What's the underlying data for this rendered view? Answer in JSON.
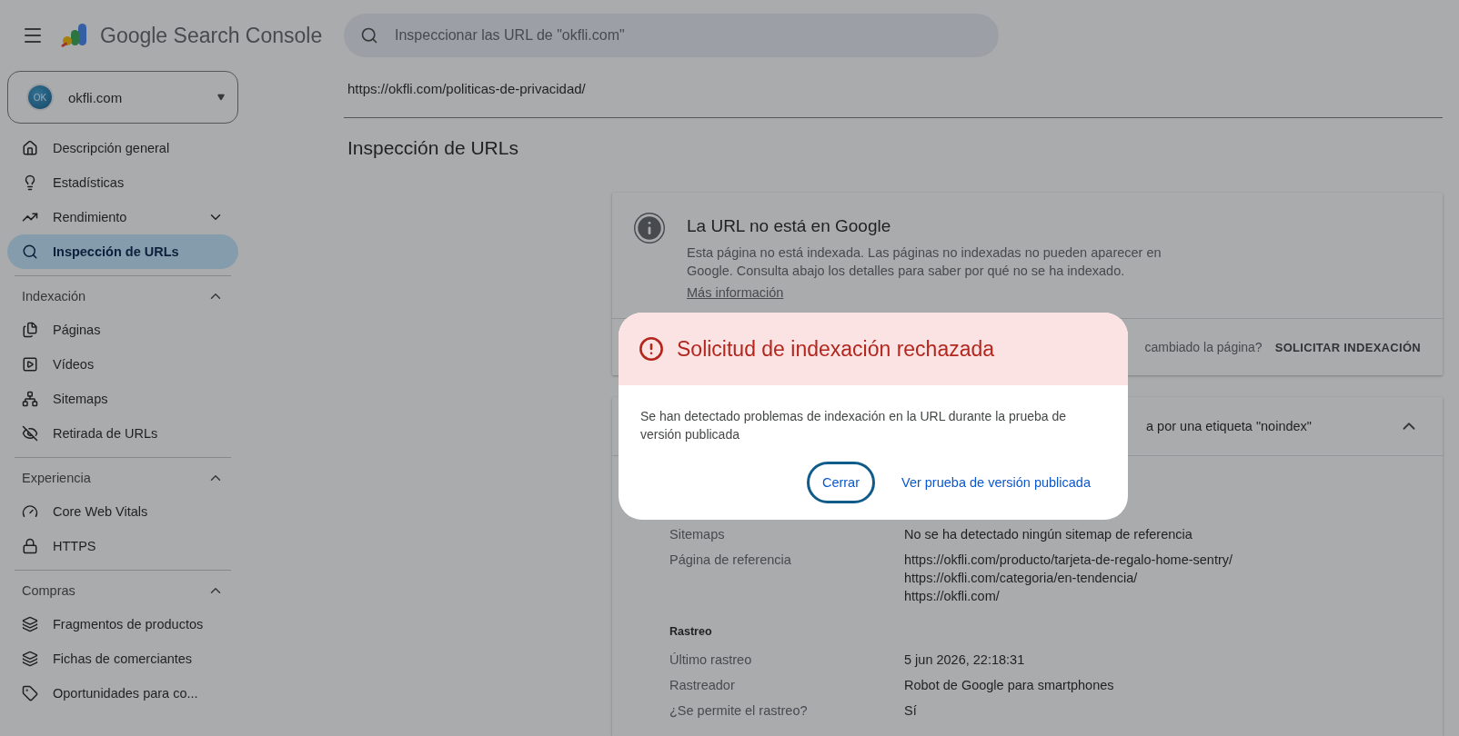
{
  "header": {
    "title": "Google Search Console"
  },
  "property": {
    "avatar": "OK",
    "name": "okfli.com"
  },
  "search": {
    "placeholder": "Inspeccionar las URL de \"okfli.com\""
  },
  "nav": [
    {
      "label": "Descripción general",
      "kind": "link",
      "selected": false
    },
    {
      "label": "Estadísticas",
      "kind": "link",
      "selected": false
    },
    {
      "label": "Rendimiento",
      "kind": "expandable",
      "expanded": false,
      "selected": false
    },
    {
      "label": "Inspección de URLs",
      "kind": "link",
      "selected": true
    }
  ],
  "sections": [
    {
      "title": "Indexación",
      "expanded": true,
      "items": [
        {
          "label": "Páginas",
          "selected": false
        },
        {
          "label": "Vídeos",
          "selected": false
        },
        {
          "label": "Sitemaps",
          "selected": false
        },
        {
          "label": "Retirada de URLs",
          "selected": false
        }
      ]
    },
    {
      "title": "Experiencia",
      "expanded": true,
      "items": [
        {
          "label": "Core Web Vitals",
          "selected": false
        },
        {
          "label": "HTTPS",
          "selected": false
        }
      ]
    },
    {
      "title": "Compras",
      "expanded": true,
      "items": [
        {
          "label": "Fragmentos de productos",
          "selected": false
        },
        {
          "label": "Fichas de comerciantes",
          "selected": false
        },
        {
          "label": "Oportunidades para co...",
          "selected": false
        }
      ]
    }
  ],
  "inspected_url": "https://okfli.com/politicas-de-privacidad/",
  "page_title": "Inspección de URLs",
  "status_card": {
    "title": "La URL no está en Google",
    "description": "Esta página no está indexada. Las páginas no indexadas no pueden aparecer en Google. Consulta abajo los detalles para saber por qué no se ha indexado.",
    "link": "Más información",
    "prompt": "cambiado la página?",
    "action": "SOLICITAR INDEXACIÓN"
  },
  "details_card": {
    "summary": "a por una etiqueta \"noindex\"",
    "expanded": true,
    "rows": [
      {
        "kind": "field",
        "label": "Sitemaps",
        "values": [
          "No se ha detectado ningún sitemap de referencia"
        ]
      },
      {
        "kind": "field",
        "label": "Página de referencia",
        "values": [
          "https://okfli.com/producto/tarjeta-de-regalo-home-sentry/",
          "https://okfli.com/categoria/en-tendencia/",
          "https://okfli.com/"
        ]
      },
      {
        "kind": "heading",
        "label": "Rastreo"
      },
      {
        "kind": "field",
        "label": "Último rastreo",
        "values": [
          "5 jun 2026, 22:18:31"
        ]
      },
      {
        "kind": "field",
        "label": "Rastreador",
        "values": [
          "Robot de Google para smartphones"
        ]
      },
      {
        "kind": "field",
        "label": "¿Se permite el rastreo?",
        "values": [
          "Sí"
        ]
      }
    ]
  },
  "dialog": {
    "title": "Solicitud de indexación rechazada",
    "message": "Se han detectado problemas de indexación en la URL durante la prueba de versión publicada",
    "buttons": [
      {
        "label": "Cerrar",
        "kind": "outlined"
      },
      {
        "label": "Ver prueba de versión publicada",
        "kind": "text"
      }
    ]
  }
}
